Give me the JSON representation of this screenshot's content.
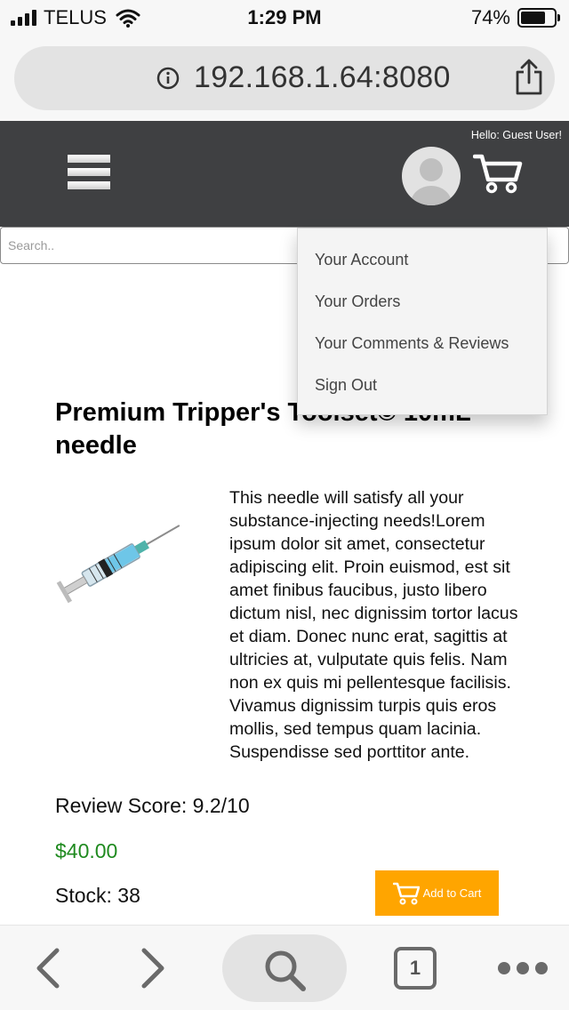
{
  "status_bar": {
    "carrier": "TELUS",
    "time": "1:29 PM",
    "battery": "74%",
    "battery_level": 0.74,
    "signal_bars": 4,
    "icons": [
      "signal-icon",
      "wifi-icon",
      "battery-icon"
    ]
  },
  "browser": {
    "url": "192.168.1.64:8080",
    "icons": [
      "info-icon",
      "share-icon"
    ]
  },
  "header": {
    "greeting": "Hello: Guest User!",
    "background_color": "#3f4042",
    "icons": [
      "hamburger-menu-icon",
      "avatar-icon",
      "cart-icon"
    ]
  },
  "search": {
    "placeholder": "Search.."
  },
  "account_menu": {
    "items": [
      "Your Account",
      "Your Orders",
      "Your Comments & Reviews",
      "Sign Out"
    ]
  },
  "product": {
    "title": "Premium Tripper's Toolset© 10mL needle",
    "description": "This needle will satisfy all your substance-injecting needs!Lorem ipsum dolor sit amet, consectetur adipiscing elit. Proin euismod, est sit amet finibus faucibus, justo libero dictum nisl, nec dignissim tortor lacus et diam. Donec nunc erat, sagittis at ultricies at, vulputate quis felis. Nam non ex quis mi pellentesque facilisis. Vivamus dignissim turpis quis eros mollis, sed tempus quam lacinia. Suspendisse sed porttitor ante.",
    "review_score": "Review Score: 9.2/10",
    "price": "$40.00",
    "price_color": "#1f8a1f",
    "stock": "Stock: 38",
    "add_to_cart_label": "Add to Cart",
    "button_color": "#ffa500",
    "image_icon": "syringe-icon"
  },
  "toolbar": {
    "tab_count": "1",
    "icons": [
      "back-icon",
      "forward-icon",
      "search-icon",
      "tabs-icon",
      "more-icon"
    ]
  }
}
